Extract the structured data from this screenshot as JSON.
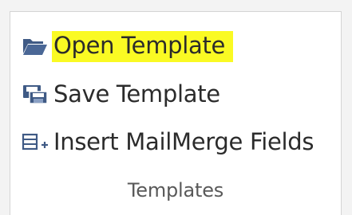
{
  "ribbon_group": {
    "label": "Templates",
    "commands": [
      {
        "label": "Open Template",
        "icon": "folder-open-icon",
        "highlighted": true
      },
      {
        "label": "Save Template",
        "icon": "save-template-icon",
        "highlighted": false
      },
      {
        "label": "Insert MailMerge Fields",
        "icon": "insert-fields-icon",
        "highlighted": false
      }
    ]
  },
  "colors": {
    "icon": "#3f5a85",
    "highlight": "#fafa23",
    "text": "#2b2b2b",
    "group_label": "#595959"
  }
}
